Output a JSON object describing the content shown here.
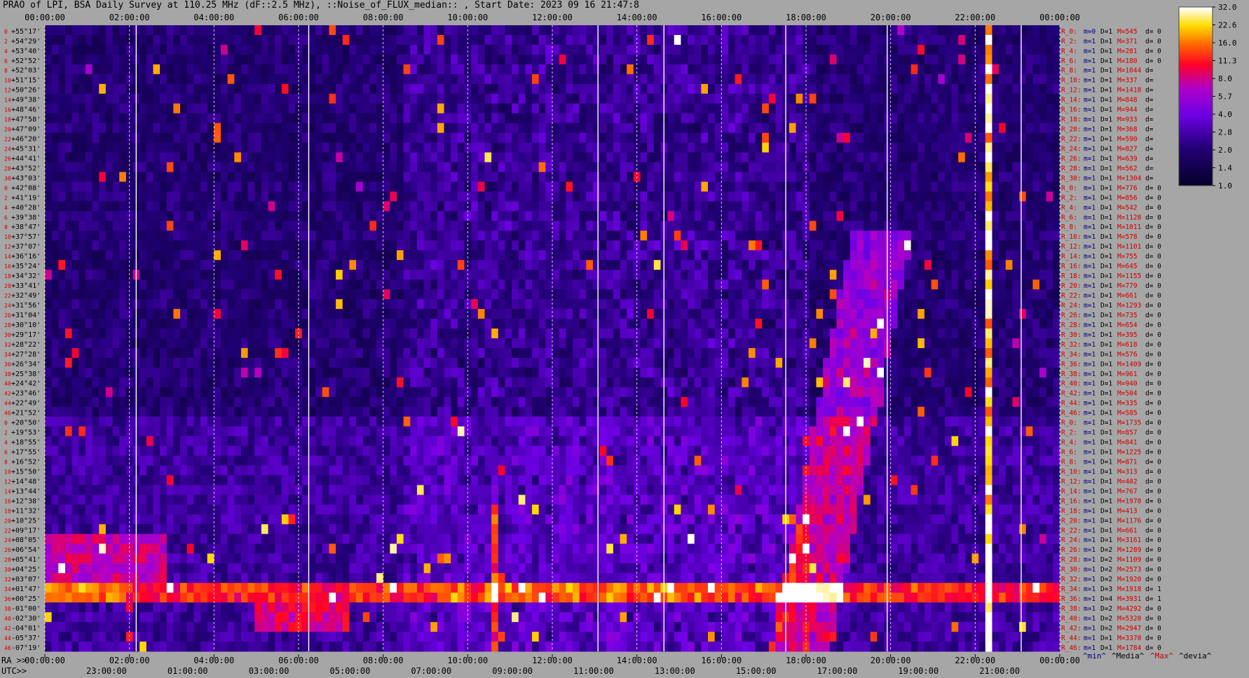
{
  "header": {
    "title": "PRAO of LPI, BSA Daily Survey at 110.25 MHz (dF::2.5 MHz), ::Noise_of_FLUX_median:: , Start Date: 2023 09 16 21:47:8"
  },
  "chart_data": {
    "type": "heatmap",
    "title": "PRAO of LPI, BSA Daily Survey at 110.25 MHz (dF::2.5 MHz), ::Noise_of_FLUX_median:: , Start Date: 2023 09 16 21:47:8",
    "x_top_ticks": [
      "00:00:00",
      "02:00:00",
      "04:00:00",
      "06:00:00",
      "08:00:00",
      "10:00:00",
      "12:00:00",
      "14:00:00",
      "16:00:00",
      "18:00:00",
      "20:00:00",
      "22:00:00",
      "00:00:00"
    ],
    "x_ra_ticks": [
      "00:00:00",
      "02:00:00",
      "04:00:00",
      "06:00:00",
      "08:00:00",
      "10:00:00",
      "12:00:00",
      "14:00:00",
      "16:00:00",
      "18:00:00",
      "20:00:00",
      "22:00:00",
      "00:00:00"
    ],
    "x_ra_label": "RA >>",
    "x_utc_ticks": [
      "23:00:00",
      "01:00:00",
      "03:00:00",
      "05:00:00",
      "07:00:00",
      "09:00:00",
      "11:00:00",
      "13:00:00",
      "15:00:00",
      "17:00:00",
      "19:00:00",
      "21:00:00"
    ],
    "x_utc_label": "UTC>>",
    "declination_labels": [
      "+55°17'",
      "+54°29'",
      "+53°40'",
      "+52°52'",
      "+52°03'",
      "+51°15'",
      "+50°26'",
      "+49°38'",
      "+48°46'",
      "+47°58'",
      "+47°09'",
      "+46°20'",
      "+45°31'",
      "+44°41'",
      "+43°52'",
      "+43°03'",
      "+42°08'",
      "+41°19'",
      "+40°28'",
      "+39°38'",
      "+38°47'",
      "+37°57'",
      "+37°07'",
      "+36°16'",
      "+35°24'",
      "+34°32'",
      "+33°41'",
      "+32°49'",
      "+31°56'",
      "+31°04'",
      "+30°10'",
      "+29°17'",
      "+28°22'",
      "+27°28'",
      "+26°34'",
      "+25°38'",
      "+24°42'",
      "+23°46'",
      "+22°49'",
      "+21°52'",
      "+20°50'",
      "+19°53'",
      "+18°55'",
      "+17°55'",
      "+16°52'",
      "+15°50'",
      "+14°48'",
      "+13°44'",
      "+12°38'",
      "+11°32'",
      "+10°25'",
      "+09°17'",
      "+08°05'",
      "+06°54'",
      "+05°41'",
      "+04°25'",
      "+03°07'",
      "+01°47'",
      "+00°25'",
      "-01°00'",
      "-02°30'",
      "-04°01'",
      "-05°37'",
      "-07°19'"
    ],
    "beam_numbers": [
      "0",
      "2",
      "4",
      "6",
      "8",
      "10",
      "12",
      "14",
      "16",
      "18",
      "20",
      "22",
      "24",
      "26",
      "28",
      "30",
      "0",
      "2",
      "4",
      "6",
      "8",
      "10",
      "12",
      "14",
      "16",
      "18",
      "20",
      "22",
      "24",
      "26",
      "28",
      "30",
      "32",
      "34",
      "36",
      "38",
      "40",
      "42",
      "44",
      "46",
      "0",
      "2",
      "4",
      "6",
      "8",
      "10",
      "12",
      "14",
      "16",
      "18",
      "20",
      "22",
      "24",
      "26",
      "28",
      "30",
      "32",
      "34",
      "36",
      "38",
      "40",
      "42",
      "44",
      "46"
    ],
    "row_stats": [
      {
        "r": "R_0:",
        "m": "m=0",
        "d": "D=1",
        "mx": "M=545",
        "dv": "d= 0"
      },
      {
        "r": "R_2:",
        "m": "m=1",
        "d": "D=1",
        "mx": "M=371",
        "dv": "d= 0"
      },
      {
        "r": "R_4:",
        "m": "m=1",
        "d": "D=1",
        "mx": "M=281",
        "dv": "d= 0"
      },
      {
        "r": "R_6:",
        "m": "m=1",
        "d": "D=1",
        "mx": "M=180",
        "dv": "d= 0"
      },
      {
        "r": "R_8:",
        "m": "m=1",
        "d": "D=1",
        "mx": "M=1044",
        "dv": "d="
      },
      {
        "r": "R_10:",
        "m": "m=1",
        "d": "D=1",
        "mx": "M=337",
        "dv": "d="
      },
      {
        "r": "R_12:",
        "m": "m=1",
        "d": "D=1",
        "mx": "M=1418",
        "dv": "d="
      },
      {
        "r": "R_14:",
        "m": "m=1",
        "d": "D=1",
        "mx": "M=848",
        "dv": "d="
      },
      {
        "r": "R_16:",
        "m": "m=1",
        "d": "D=1",
        "mx": "M=944",
        "dv": "d="
      },
      {
        "r": "R_18:",
        "m": "m=1",
        "d": "D=1",
        "mx": "M=933",
        "dv": "d="
      },
      {
        "r": "R_20:",
        "m": "m=1",
        "d": "D=1",
        "mx": "M=368",
        "dv": "d="
      },
      {
        "r": "R_22:",
        "m": "m=1",
        "d": "D=1",
        "mx": "M=590",
        "dv": "d="
      },
      {
        "r": "R_24:",
        "m": "m=1",
        "d": "D=1",
        "mx": "M=827",
        "dv": "d="
      },
      {
        "r": "R_26:",
        "m": "m=1",
        "d": "D=1",
        "mx": "M=639",
        "dv": "d="
      },
      {
        "r": "R_28:",
        "m": "m=1",
        "d": "D=1",
        "mx": "M=562",
        "dv": "d="
      },
      {
        "r": "R_30:",
        "m": "m=1",
        "d": "D=1",
        "mx": "M=1304",
        "dv": "d="
      },
      {
        "r": "R_0:",
        "m": "m=1",
        "d": "D=1",
        "mx": "M=776",
        "dv": "d= 0"
      },
      {
        "r": "R_2:",
        "m": "m=1",
        "d": "D=1",
        "mx": "M=856",
        "dv": "d= 0"
      },
      {
        "r": "R_4:",
        "m": "m=1",
        "d": "D=1",
        "mx": "M=542",
        "dv": "d= 0"
      },
      {
        "r": "R_6:",
        "m": "m=1",
        "d": "D=1",
        "mx": "M=1128",
        "dv": "d= 0"
      },
      {
        "r": "R_8:",
        "m": "m=1",
        "d": "D=1",
        "mx": "M=1011",
        "dv": "d= 0"
      },
      {
        "r": "R_10:",
        "m": "m=1",
        "d": "D=1",
        "mx": "M=578",
        "dv": "d= 0"
      },
      {
        "r": "R_12:",
        "m": "m=1",
        "d": "D=1",
        "mx": "M=1101",
        "dv": "d= 0"
      },
      {
        "r": "R_14:",
        "m": "m=1",
        "d": "D=1",
        "mx": "M=755",
        "dv": "d= 0"
      },
      {
        "r": "R_16:",
        "m": "m=1",
        "d": "D=1",
        "mx": "M=645",
        "dv": "d= 0"
      },
      {
        "r": "R_18:",
        "m": "m=1",
        "d": "D=1",
        "mx": "M=1155",
        "dv": "d= 0"
      },
      {
        "r": "R_20:",
        "m": "m=1",
        "d": "D=1",
        "mx": "M=779",
        "dv": "d= 0"
      },
      {
        "r": "R_22:",
        "m": "m=1",
        "d": "D=1",
        "mx": "M=661",
        "dv": "d= 0"
      },
      {
        "r": "R_24:",
        "m": "m=1",
        "d": "D=1",
        "mx": "M=1293",
        "dv": "d= 0"
      },
      {
        "r": "R_26:",
        "m": "m=1",
        "d": "D=1",
        "mx": "M=735",
        "dv": "d= 0"
      },
      {
        "r": "R_28:",
        "m": "m=1",
        "d": "D=1",
        "mx": "M=654",
        "dv": "d= 0"
      },
      {
        "r": "R_30:",
        "m": "m=1",
        "d": "D=1",
        "mx": "M=395",
        "dv": "d= 0"
      },
      {
        "r": "R_32:",
        "m": "m=1",
        "d": "D=1",
        "mx": "M=618",
        "dv": "d= 0"
      },
      {
        "r": "R_34:",
        "m": "m=1",
        "d": "D=1",
        "mx": "M=576",
        "dv": "d= 0"
      },
      {
        "r": "R_36:",
        "m": "m=1",
        "d": "D=1",
        "mx": "M=1409",
        "dv": "d= 0"
      },
      {
        "r": "R_38:",
        "m": "m=1",
        "d": "D=1",
        "mx": "M=961",
        "dv": "d= 0"
      },
      {
        "r": "R_40:",
        "m": "m=1",
        "d": "D=1",
        "mx": "M=940",
        "dv": "d= 0"
      },
      {
        "r": "R_42:",
        "m": "m=1",
        "d": "D=1",
        "mx": "M=504",
        "dv": "d= 0"
      },
      {
        "r": "R_44:",
        "m": "m=1",
        "d": "D=1",
        "mx": "M=335",
        "dv": "d= 0"
      },
      {
        "r": "R_46:",
        "m": "m=1",
        "d": "D=1",
        "mx": "M=585",
        "dv": "d= 0"
      },
      {
        "r": "R_0:",
        "m": "m=1",
        "d": "D=1",
        "mx": "M=1735",
        "dv": "d= 0"
      },
      {
        "r": "R_2:",
        "m": "m=1",
        "d": "D=1",
        "mx": "M=857",
        "dv": "d= 0"
      },
      {
        "r": "R_4:",
        "m": "m=1",
        "d": "D=1",
        "mx": "M=841",
        "dv": "d= 0"
      },
      {
        "r": "R_6:",
        "m": "m=1",
        "d": "D=1",
        "mx": "M=1225",
        "dv": "d= 0"
      },
      {
        "r": "R_8:",
        "m": "m=1",
        "d": "D=1",
        "mx": "M=871",
        "dv": "d= 0"
      },
      {
        "r": "R_10:",
        "m": "m=1",
        "d": "D=1",
        "mx": "M=313",
        "dv": "d= 0"
      },
      {
        "r": "R_12:",
        "m": "m=1",
        "d": "D=1",
        "mx": "M=402",
        "dv": "d= 0"
      },
      {
        "r": "R_14:",
        "m": "m=1",
        "d": "D=1",
        "mx": "M=767",
        "dv": "d= 0"
      },
      {
        "r": "R_16:",
        "m": "m=1",
        "d": "D=1",
        "mx": "M=1970",
        "dv": "d= 0"
      },
      {
        "r": "R_18:",
        "m": "m=1",
        "d": "D=1",
        "mx": "M=413",
        "dv": "d= 0"
      },
      {
        "r": "R_20:",
        "m": "m=1",
        "d": "D=1",
        "mx": "M=1176",
        "dv": "d= 0"
      },
      {
        "r": "R_22:",
        "m": "m=1",
        "d": "D=1",
        "mx": "M=661",
        "dv": "d= 0"
      },
      {
        "r": "R_24:",
        "m": "m=1",
        "d": "D=1",
        "mx": "M=3161",
        "dv": "d= 0"
      },
      {
        "r": "R_26:",
        "m": "m=1",
        "d": "D=2",
        "mx": "M=1289",
        "dv": "d= 0"
      },
      {
        "r": "R_28:",
        "m": "m=1",
        "d": "D=2",
        "mx": "M=1109",
        "dv": "d= 0"
      },
      {
        "r": "R_30:",
        "m": "m=1",
        "d": "D=2",
        "mx": "M=2573",
        "dv": "d= 0"
      },
      {
        "r": "R_32:",
        "m": "m=1",
        "d": "D=2",
        "mx": "M=1920",
        "dv": "d= 0"
      },
      {
        "r": "R_34:",
        "m": "m=1",
        "d": "D=3",
        "mx": "M=1918",
        "dv": "d= 1"
      },
      {
        "r": "R_36:",
        "m": "m=1",
        "d": "D=4",
        "mx": "M=3931",
        "dv": "d= 1"
      },
      {
        "r": "R_38:",
        "m": "m=1",
        "d": "D=2",
        "mx": "M=4292",
        "dv": "d= 0"
      },
      {
        "r": "R_40:",
        "m": "m=1",
        "d": "D=2",
        "mx": "M=5320",
        "dv": "d= 0"
      },
      {
        "r": "R_42:",
        "m": "m=1",
        "d": "D=2",
        "mx": "M=2947",
        "dv": "d= 0"
      },
      {
        "r": "R_44:",
        "m": "m=1",
        "d": "D=1",
        "mx": "M=3370",
        "dv": "d= 0"
      },
      {
        "r": "R_46:",
        "m": "m=1",
        "d": "D=1",
        "mx": "M=1784",
        "dv": "d= 0"
      }
    ],
    "colorbar_ticks": [
      "32.0",
      "22.6",
      "16.0",
      "11.3",
      "8.0",
      "5.7",
      "4.0",
      "2.8",
      "2.0",
      "1.4",
      "1.0"
    ],
    "stats_legend": [
      "^min^",
      "^Media^",
      "^Max^",
      "^devia^"
    ],
    "colors": {
      "bg": "#a6a6a6",
      "low": "#05003a",
      "mid": "#8a00ff",
      "hi": "#ff1010",
      "top": "#ffffff",
      "min_label": "#000080",
      "max_label": "#ff0000"
    },
    "grid": true,
    "legend_position": "right"
  }
}
